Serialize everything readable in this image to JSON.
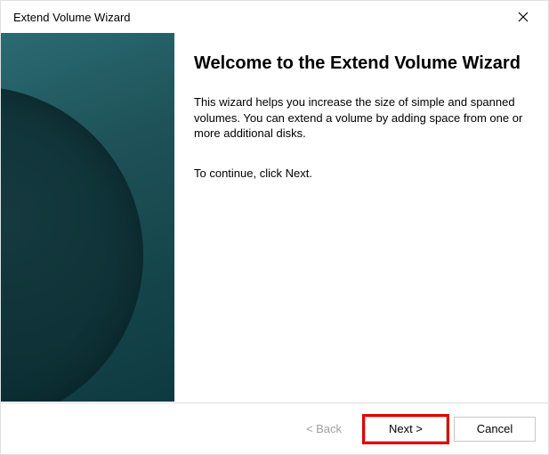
{
  "titlebar": {
    "title": "Extend Volume Wizard"
  },
  "main": {
    "heading": "Welcome to the Extend Volume Wizard",
    "description": "This wizard helps you increase the size of simple and spanned volumes. You can extend a volume  by adding space from one or more additional disks.",
    "instruction": "To continue, click Next."
  },
  "buttons": {
    "back": "< Back",
    "next": "Next >",
    "cancel": "Cancel"
  }
}
